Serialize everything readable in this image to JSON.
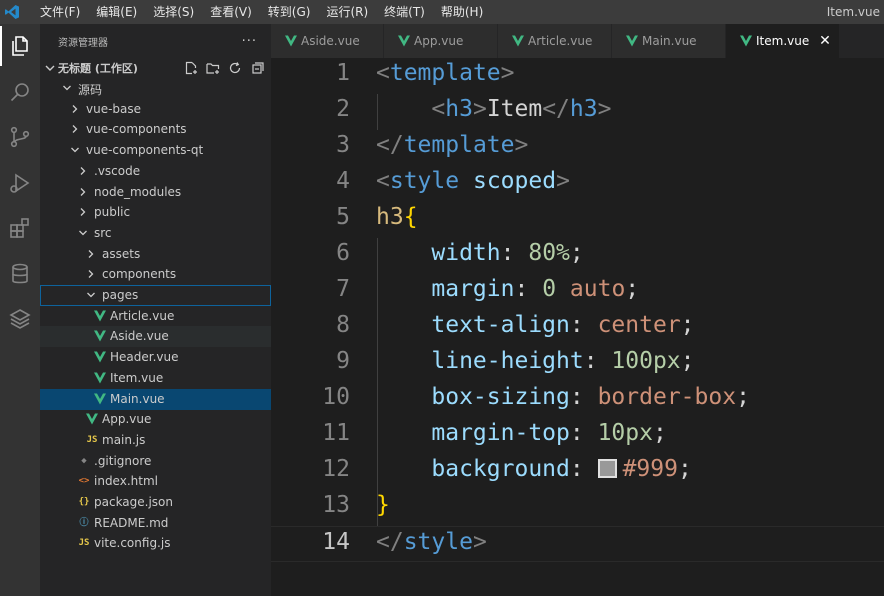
{
  "titlebar": {
    "menu": [
      "文件(F)",
      "编辑(E)",
      "选择(S)",
      "查看(V)",
      "转到(G)",
      "运行(R)",
      "终端(T)",
      "帮助(H)"
    ],
    "window_title": "Item.vue"
  },
  "activity_bar": {
    "icons": [
      "explorer-icon",
      "search-icon",
      "source-control-icon",
      "run-debug-icon",
      "extensions-icon",
      "database-icon",
      "layers-icon"
    ]
  },
  "sidebar": {
    "title": "资源管理器",
    "more": "···",
    "workspace": "无标题 (工作区)",
    "tree": [
      {
        "label": "源码",
        "type": "folder",
        "open": true
      },
      {
        "label": "vue-base",
        "type": "folder",
        "open": false
      },
      {
        "label": "vue-components",
        "type": "folder",
        "open": false
      },
      {
        "label": "vue-components-qt",
        "type": "folder",
        "open": true
      },
      {
        "label": ".vscode",
        "type": "folder",
        "open": false
      },
      {
        "label": "node_modules",
        "type": "folder",
        "open": false
      },
      {
        "label": "public",
        "type": "folder",
        "open": false
      },
      {
        "label": "src",
        "type": "folder",
        "open": true
      },
      {
        "label": "assets",
        "type": "folder",
        "open": false
      },
      {
        "label": "components",
        "type": "folder",
        "open": false
      },
      {
        "label": "pages",
        "type": "folder",
        "open": true
      },
      {
        "label": "Article.vue",
        "type": "vue"
      },
      {
        "label": "Aside.vue",
        "type": "vue"
      },
      {
        "label": "Header.vue",
        "type": "vue"
      },
      {
        "label": "Item.vue",
        "type": "vue"
      },
      {
        "label": "Main.vue",
        "type": "vue"
      },
      {
        "label": "App.vue",
        "type": "vue"
      },
      {
        "label": "main.js",
        "type": "js"
      },
      {
        "label": ".gitignore",
        "type": "git"
      },
      {
        "label": "index.html",
        "type": "html"
      },
      {
        "label": "package.json",
        "type": "json"
      },
      {
        "label": "README.md",
        "type": "md"
      },
      {
        "label": "vite.config.js",
        "type": "js"
      }
    ],
    "selected": "Main.vue",
    "focused": "pages",
    "hovered": "Aside.vue"
  },
  "tabs": [
    {
      "label": "Aside.vue",
      "active": false
    },
    {
      "label": "App.vue",
      "active": false
    },
    {
      "label": "Article.vue",
      "active": false
    },
    {
      "label": "Main.vue",
      "active": false
    },
    {
      "label": "Item.vue",
      "active": true
    }
  ],
  "tab_close": "✕",
  "editor": {
    "current_line": 14,
    "line_numbers": [
      "1",
      "2",
      "3",
      "4",
      "5",
      "6",
      "7",
      "8",
      "9",
      "10",
      "11",
      "12",
      "13",
      "14"
    ],
    "lines": [
      {
        "lt": "<",
        "tag": "template",
        "gt": ">"
      },
      {
        "lt": "<",
        "tag": "h3",
        "gt": ">",
        "text": "Item",
        "lt2": "</",
        "tag2": "h3",
        "gt2": ">"
      },
      {
        "lt": "</",
        "tag": "template",
        "gt": ">"
      },
      {
        "lt": "<",
        "tag": "style",
        "attr": "scoped",
        "gt": ">"
      },
      {
        "selector": "h3",
        "brace": "{"
      },
      {
        "prop": "width",
        "colon": ": ",
        "value": "80%",
        "semi": ";"
      },
      {
        "prop": "margin",
        "colon": ": ",
        "value": "0",
        "value2": "auto",
        "semi": ";"
      },
      {
        "prop": "text-align",
        "colon": ": ",
        "value": "center",
        "semi": ";"
      },
      {
        "prop": "line-height",
        "colon": ": ",
        "value": "100px",
        "semi": ";"
      },
      {
        "prop": "box-sizing",
        "colon": ": ",
        "value": "border-box",
        "semi": ";"
      },
      {
        "prop": "margin-top",
        "colon": ": ",
        "value": "10px",
        "semi": ";"
      },
      {
        "prop": "background",
        "colon": ": ",
        "value": "#999",
        "semi": ";"
      },
      {
        "brace": "}"
      },
      {
        "lt": "</",
        "tag": "style",
        "gt": ">"
      }
    ]
  },
  "colors": {
    "vue_green": "#41b883",
    "accent_blue": "#0e639c",
    "selection": "#094771",
    "swatch": "#999999"
  }
}
